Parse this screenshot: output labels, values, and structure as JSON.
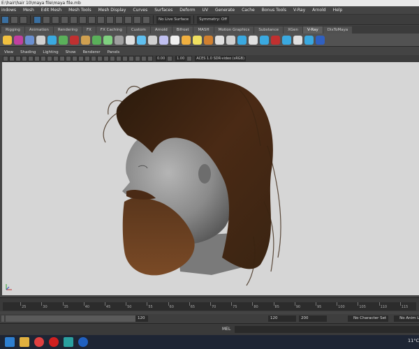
{
  "window": {
    "title": "E:\\hair\\hair 10\\maya file\\maya file.mb"
  },
  "menubar": [
    "indows",
    "Mesh",
    "Edit Mesh",
    "Mesh Tools",
    "Mesh Display",
    "Curves",
    "Surfaces",
    "Deform",
    "UV",
    "Generate",
    "Cache",
    "Bonus Tools",
    "V-Ray",
    "Arnold",
    "Help"
  ],
  "statusline": {
    "live_surface": "No Live Surface",
    "symmetry": "Symmetry: Off"
  },
  "shelf_tabs": [
    "Rigging",
    "Animation",
    "Rendering",
    "FX",
    "FX Caching",
    "Custom",
    "Arnold",
    "Bifrost",
    "MASH",
    "Motion Graphics",
    "Substance",
    "XGen",
    "V-Ray",
    "DixToMaya"
  ],
  "shelf_active_tab": "V-Ray",
  "panel_menu": [
    "View",
    "Shading",
    "Lighting",
    "Show",
    "Renderer",
    "Panels"
  ],
  "panel_toolbar": {
    "exposure": "0.00",
    "gamma": "1.00",
    "color_space": "ACES 1.0 SDR-video (sRGB)"
  },
  "timeslider": {
    "ticks": [
      "25",
      "30",
      "35",
      "40",
      "45",
      "50",
      "55",
      "60",
      "65",
      "70",
      "75",
      "80",
      "85",
      "90",
      "95",
      "100",
      "105",
      "110",
      "115"
    ]
  },
  "rangeslider": {
    "range_end": "120",
    "anim_end": "120",
    "anim_max": "200",
    "character_set": "No Character Set",
    "anim_layer": "No Anim Layer"
  },
  "cmdline": {
    "label": "MEL"
  },
  "taskbar": {
    "weather": "11°C"
  },
  "colors": {
    "viewport_bg": "#d6d6d6",
    "hair": "#4a2a15",
    "skin": "#8a8a8a",
    "accent": "#3a6fa0"
  }
}
